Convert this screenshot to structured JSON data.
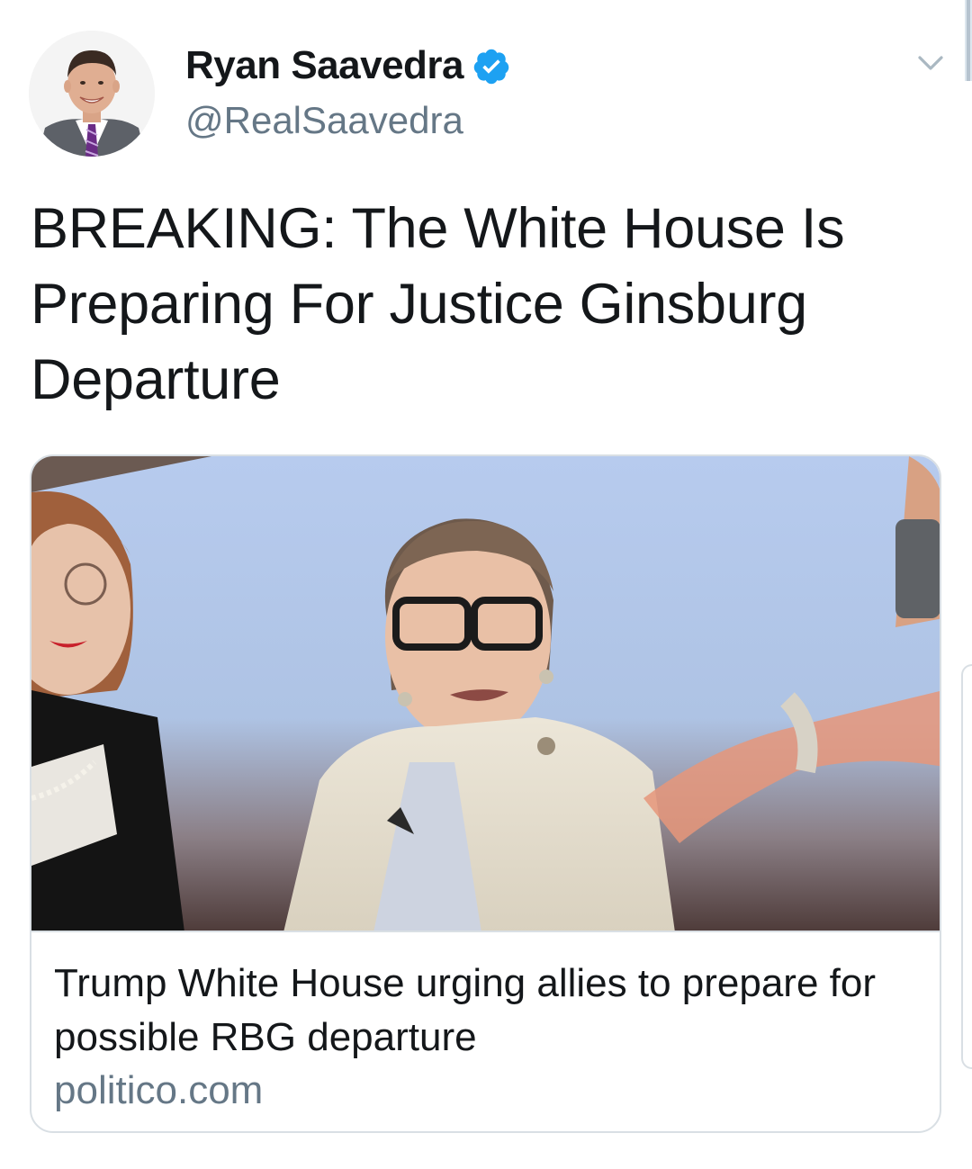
{
  "tweet": {
    "author": {
      "display_name": "Ryan Saavedra",
      "handle": "@RealSaavedra",
      "verified": true,
      "avatar_icon": "profile-photo"
    },
    "text": "BREAKING: The White House Is Preparing For Justice Ginsburg Departure",
    "card": {
      "image": "news-photo",
      "title": "Trump White House urging allies to prepare for possible RBG departure",
      "domain": "politico.com"
    }
  },
  "icons": {
    "verified": "verified-badge-icon",
    "menu": "chevron-down-icon"
  },
  "colors": {
    "text": "#14171a",
    "secondary": "#657786",
    "verified_blue": "#1da1f2",
    "border": "#d9dfe4"
  }
}
